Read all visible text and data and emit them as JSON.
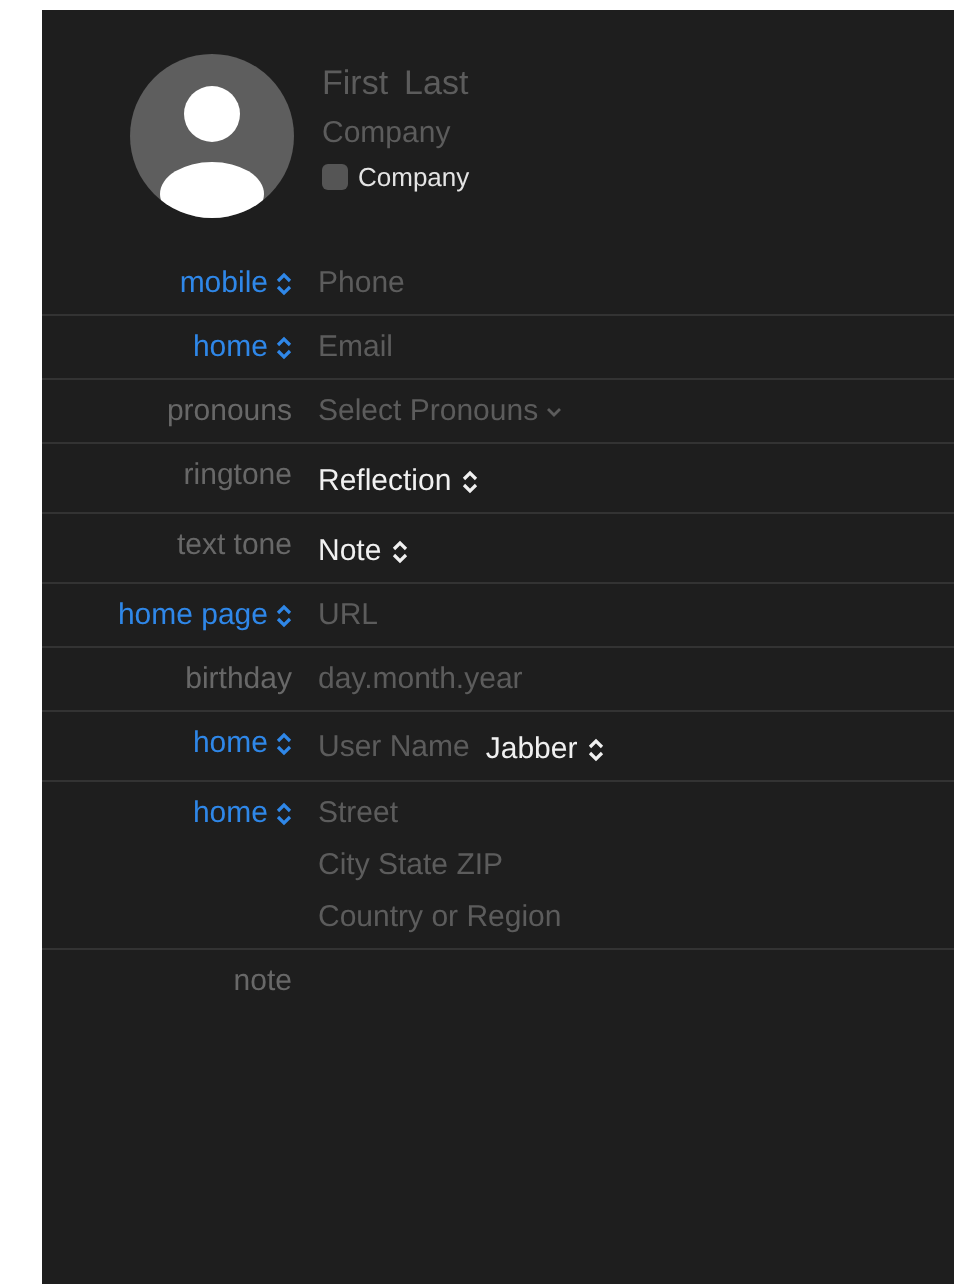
{
  "name_placeholders": [
    "First",
    "Last"
  ],
  "company_placeholder": "Company",
  "company_checkbox": {
    "label": "Company",
    "checked": false
  },
  "rows": [
    {
      "label": "mobile",
      "kind": "popup",
      "items": [
        {
          "kind": "placeholder",
          "text": "Phone"
        }
      ]
    },
    {
      "label": "home",
      "kind": "popup",
      "items": [
        {
          "kind": "placeholder",
          "text": "Email"
        }
      ]
    },
    {
      "label": "pronouns",
      "kind": "plain",
      "items": [
        {
          "kind": "menu",
          "text": "Select Pronouns"
        }
      ]
    },
    {
      "label": "ringtone",
      "kind": "plain",
      "items": [
        {
          "kind": "popup",
          "text": "Reflection"
        }
      ]
    },
    {
      "label": "text tone",
      "kind": "plain",
      "items": [
        {
          "kind": "popup",
          "text": "Note"
        }
      ]
    },
    {
      "label": "home page",
      "kind": "popup",
      "items": [
        {
          "kind": "placeholder",
          "text": "URL"
        }
      ]
    },
    {
      "label": "birthday",
      "kind": "plain",
      "items": [
        {
          "kind": "placeholder",
          "text": "day.month.year"
        }
      ]
    },
    {
      "label": "home",
      "kind": "popup",
      "items": [
        {
          "kind": "placeholder",
          "text": "User Name"
        },
        {
          "kind": "popup",
          "text": "Jabber"
        }
      ]
    },
    {
      "label": "home",
      "kind": "popup",
      "items": [
        {
          "kind": "address",
          "lines": [
            "Street",
            "City State ZIP",
            "Country or Region"
          ]
        }
      ]
    },
    {
      "label": "note",
      "kind": "plain",
      "items": []
    }
  ]
}
